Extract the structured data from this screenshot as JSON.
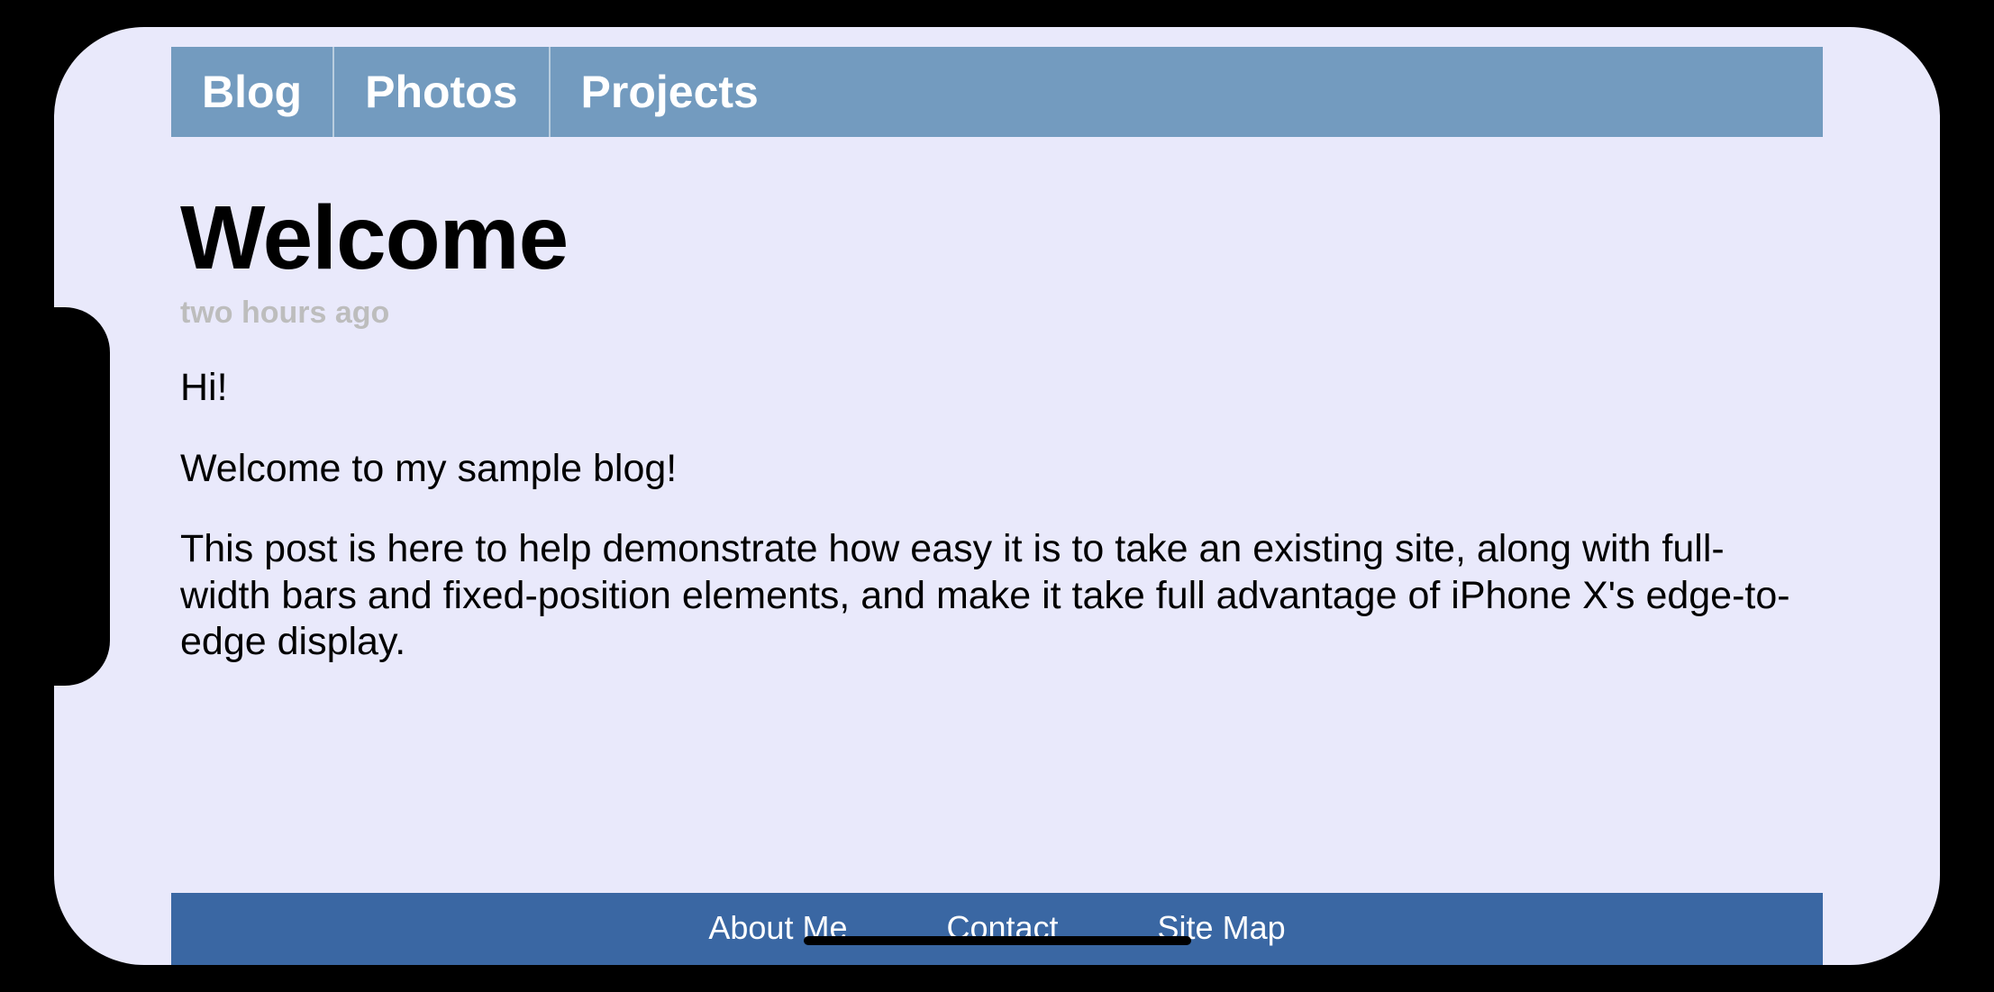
{
  "colors": {
    "page_bg": "#e9e9fb",
    "topbar_bg": "#739bbf",
    "bottombar_bg": "#3a67a3",
    "text": "#000000",
    "nav_text": "#ffffff",
    "timestamp": "#bdbdbd"
  },
  "topnav": {
    "items": [
      {
        "label": "Blog"
      },
      {
        "label": "Photos"
      },
      {
        "label": "Projects"
      }
    ]
  },
  "post": {
    "title": "Welcome",
    "timestamp": "two hours ago",
    "paragraphs": [
      "Hi!",
      "Welcome to my sample blog!",
      "This post is here to help demonstrate how easy it is to take an existing site, along with full-width bars and fixed-position elements, and make it take full advantage of iPhone X's edge-to-edge display."
    ]
  },
  "bottomnav": {
    "items": [
      {
        "label": "About Me"
      },
      {
        "label": "Contact"
      },
      {
        "label": "Site Map"
      }
    ]
  }
}
